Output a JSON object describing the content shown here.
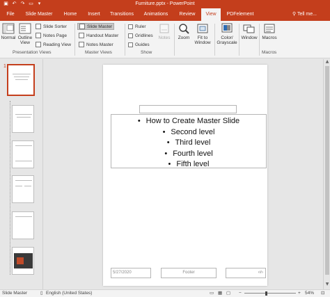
{
  "titlebar": {
    "title": "Furniture.pptx - PowerPoint",
    "icons": [
      "save-icon",
      "undo-icon",
      "redo-icon",
      "presenter-icon",
      "customize-icon"
    ]
  },
  "tabs": [
    {
      "label": "File",
      "active": false
    },
    {
      "label": "Slide Master",
      "active": false
    },
    {
      "label": "Home",
      "active": false
    },
    {
      "label": "Insert",
      "active": false
    },
    {
      "label": "Transitions",
      "active": false
    },
    {
      "label": "Animations",
      "active": false
    },
    {
      "label": "Review",
      "active": false
    },
    {
      "label": "View",
      "active": true
    },
    {
      "label": "PDFelement",
      "active": false
    }
  ],
  "tellme": "Tell me...",
  "ribbon": {
    "presentation_views": {
      "label": "Presentation Views",
      "normal": "Normal",
      "outline_view": "Outline View",
      "slide_sorter": "Slide Sorter",
      "notes_page": "Notes Page",
      "reading_view": "Reading View"
    },
    "master_views": {
      "label": "Master Views",
      "slide_master": "Slide Master",
      "handout_master": "Handout Master",
      "notes_master": "Notes Master"
    },
    "show": {
      "label": "Show",
      "ruler": "Ruler",
      "gridlines": "Gridlines",
      "guides": "Guides",
      "notes": "Notes"
    },
    "zoom": {
      "zoom": "Zoom",
      "fit_to_window": "Fit to Window"
    },
    "color": {
      "color_grayscale": "Color/ Grayscale"
    },
    "window": {
      "window": "Window"
    },
    "macros": {
      "label": "Macros",
      "macros": "Macros"
    }
  },
  "thumbnails": {
    "first_number": "1",
    "count": 6,
    "selected_index": 0
  },
  "slide": {
    "body_levels": [
      "How to Create Master Slide",
      "Second level",
      "Third level",
      "Fourth level",
      "Fifth level"
    ],
    "date": "5/27/2020",
    "footer": "Footer",
    "slide_number": "‹#›"
  },
  "statusbar": {
    "view": "Slide Master",
    "language": "English (United States)",
    "zoom_percent": "54%",
    "zoom_minus": "−",
    "zoom_plus": "+"
  },
  "colors": {
    "accent": "#c43e1c",
    "ribbon_bg": "#f3f3f3",
    "workspace_bg": "#e6e6e6"
  }
}
